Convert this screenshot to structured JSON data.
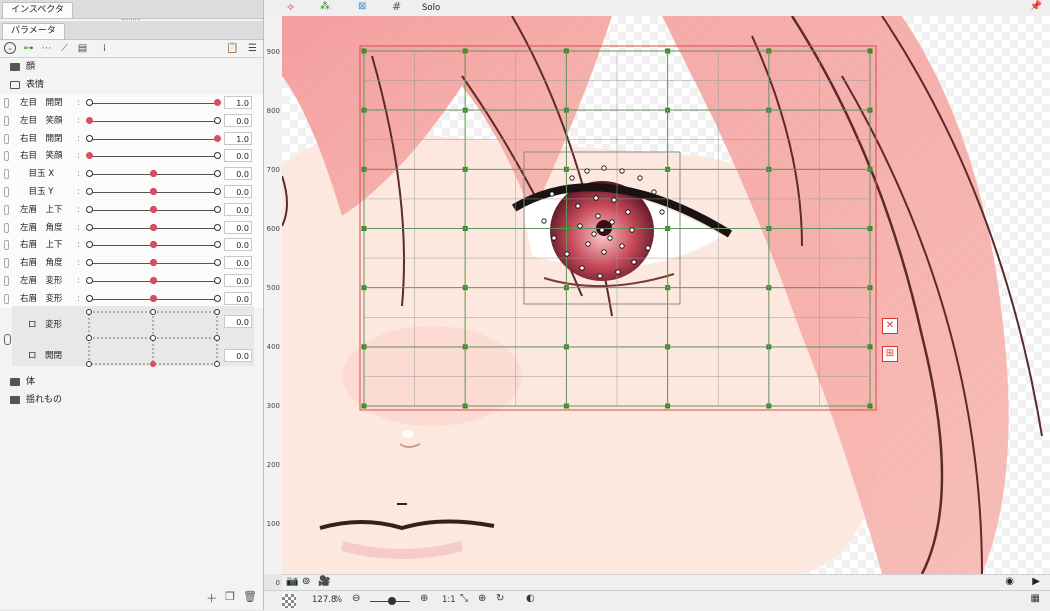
{
  "inspector_tab": "インスペクタ",
  "parameter_tab": "パラメータ",
  "groups": {
    "face": "顔",
    "expression": "表情",
    "body": "体",
    "swaying": "揺れもの"
  },
  "params": [
    {
      "label": "左目　開閉",
      "value": "1.0",
      "knob": 1.0
    },
    {
      "label": "左目　笑顔",
      "value": "0.0",
      "knob": 0.0
    },
    {
      "label": "右目　開閉",
      "value": "1.0",
      "knob": 1.0
    },
    {
      "label": "右目　笑顔",
      "value": "0.0",
      "knob": 0.0
    },
    {
      "label": "　目玉 X",
      "value": "0.0",
      "knob": 0.5
    },
    {
      "label": "　目玉 Y",
      "value": "0.0",
      "knob": 0.5
    },
    {
      "label": "左眉　上下",
      "value": "0.0",
      "knob": 0.5
    },
    {
      "label": "左眉　角度",
      "value": "0.0",
      "knob": 0.5
    },
    {
      "label": "右眉　上下",
      "value": "0.0",
      "knob": 0.5
    },
    {
      "label": "右眉　角度",
      "value": "0.0",
      "knob": 0.5
    },
    {
      "label": "左眉　変形",
      "value": "0.0",
      "knob": 0.5
    },
    {
      "label": "右眉　変形",
      "value": "0.0",
      "knob": 0.5
    }
  ],
  "blend": {
    "row1_label": "ロ　変形",
    "row1_value": "0.0",
    "row2_label": "ロ　開閉",
    "row2_value": "0.0"
  },
  "topbar": {
    "solo_label": "Solo"
  },
  "ruler_labels": [
    "900",
    "800",
    "700",
    "600",
    "500",
    "400",
    "300",
    "200",
    "100",
    "0"
  ],
  "status": {
    "zoom": "127.8",
    "zoom_unit": "%",
    "ratio": "1:1"
  },
  "colors": {
    "accent_red": "#d85060",
    "mesh_green": "#2e8b1e",
    "hair_pink": "#f4a3a3"
  },
  "icons": [
    "search-icon",
    "camera-icon",
    "zoom-out-icon",
    "zoom-in-icon",
    "play-icon",
    "add-icon",
    "delete-icon",
    "pin-icon"
  ]
}
